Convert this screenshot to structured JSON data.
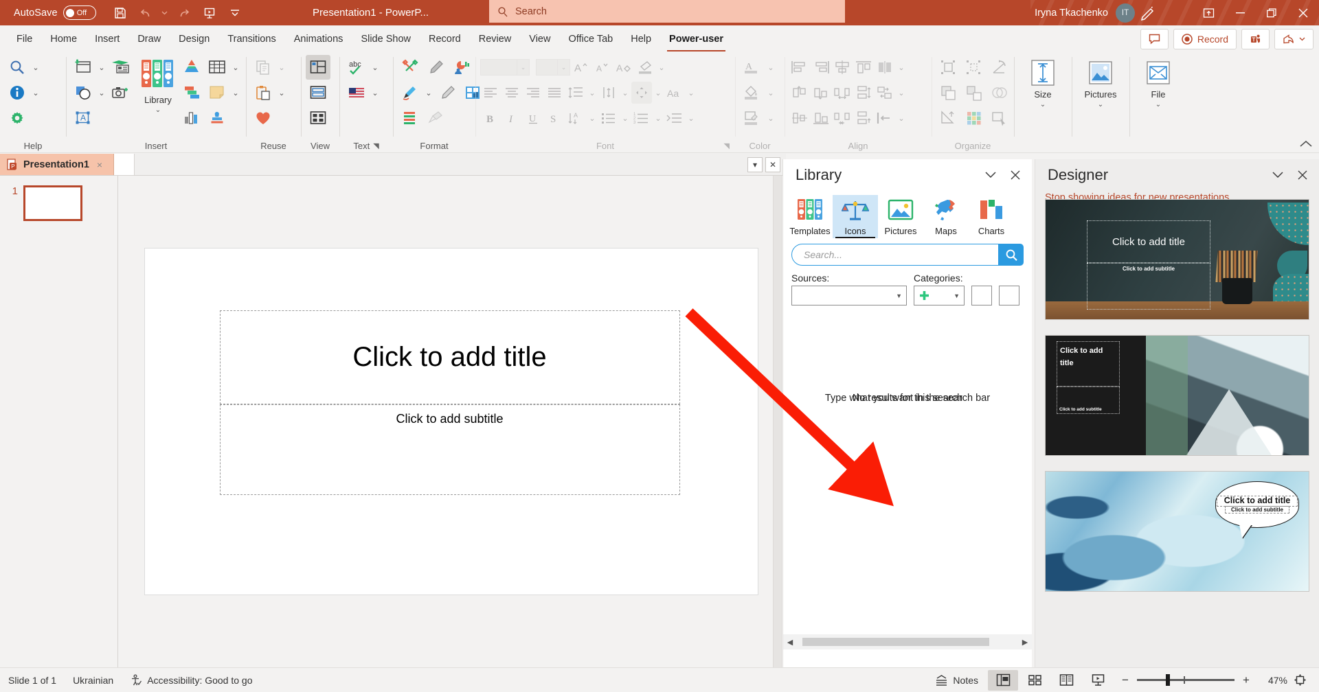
{
  "titlebar": {
    "autosave_label": "AutoSave",
    "autosave_state": "Off",
    "document_title": "Presentation1  -  PowerP...",
    "search_placeholder": "Search",
    "user_name": "Iryna Tkachenko",
    "user_initials": "IT",
    "quick_access": [
      "save-icon",
      "undo-icon",
      "redo-icon",
      "start-slideshow-icon",
      "customize-qat-icon"
    ],
    "window_controls": [
      "minimize",
      "restore",
      "close"
    ],
    "accent_color": "#b7472a"
  },
  "ribbon": {
    "tabs": [
      {
        "label": "File",
        "active": false
      },
      {
        "label": "Home",
        "active": false
      },
      {
        "label": "Insert",
        "active": false
      },
      {
        "label": "Draw",
        "active": false
      },
      {
        "label": "Design",
        "active": false
      },
      {
        "label": "Transitions",
        "active": false
      },
      {
        "label": "Animations",
        "active": false
      },
      {
        "label": "Slide Show",
        "active": false
      },
      {
        "label": "Record",
        "active": false
      },
      {
        "label": "Review",
        "active": false
      },
      {
        "label": "View",
        "active": false
      },
      {
        "label": "Office Tab",
        "active": false
      },
      {
        "label": "Help",
        "active": false
      },
      {
        "label": "Power-user",
        "active": true
      }
    ],
    "right_buttons": [
      {
        "label": "",
        "name": "comments-button",
        "icon": "comment-icon"
      },
      {
        "label": "Record",
        "name": "record-button",
        "icon": "record-circle-icon"
      },
      {
        "label": "",
        "name": "teams-button",
        "icon": "teams-icon"
      },
      {
        "label": "",
        "name": "share-button",
        "icon": "share-icon"
      }
    ],
    "groups": [
      {
        "label": "Help"
      },
      {
        "label": "Insert",
        "big_button": "Library"
      },
      {
        "label": "Reuse"
      },
      {
        "label": "View"
      },
      {
        "label": "Text"
      },
      {
        "label": "Format"
      },
      {
        "label": "Font"
      },
      {
        "label": "Color"
      },
      {
        "label": "Align"
      },
      {
        "label": "Organize"
      },
      {
        "label": "Size"
      },
      {
        "label": "Pictures"
      },
      {
        "label": "File"
      }
    ],
    "big_buttons": [
      {
        "label": "Size",
        "name": "size-button"
      },
      {
        "label": "Pictures",
        "name": "pictures-button"
      },
      {
        "label": "File",
        "name": "file-button"
      }
    ]
  },
  "office_tabs": {
    "tabs": [
      {
        "label": "Presentation1",
        "active": true
      }
    ],
    "close_symbol": "×"
  },
  "thumbnails": {
    "slides": [
      {
        "number": "1"
      }
    ]
  },
  "slide": {
    "title_placeholder": "Click to add title",
    "subtitle_placeholder": "Click to add subtitle"
  },
  "library": {
    "title": "Library",
    "tabs": [
      {
        "label": "Templates",
        "selected": false,
        "icon": "binders-icon"
      },
      {
        "label": "Icons",
        "selected": true,
        "icon": "scales-icon"
      },
      {
        "label": "Pictures",
        "selected": false,
        "icon": "picture-icon"
      },
      {
        "label": "Maps",
        "selected": false,
        "icon": "map-icon"
      },
      {
        "label": "Charts",
        "selected": false,
        "icon": "bar-chart-icon"
      }
    ],
    "search_placeholder": "Search...",
    "sources_label": "Sources:",
    "sources_value": "",
    "categories_label": "Categories:",
    "message_primary": "Type what you want in the search bar",
    "message_secondary": "No results for this search"
  },
  "designer": {
    "title": "Designer",
    "stop_link": "Stop showing ideas for new presentations",
    "ideas": [
      {
        "name": "chalkboard-pencils-design",
        "title": "Click to add title",
        "subtitle": "Click to add subtitle"
      },
      {
        "name": "mountains-design",
        "title": "Click to add title",
        "subtitle": "Click to add subtitle"
      },
      {
        "name": "watercolor-ink-design",
        "title": "Click to add title",
        "subtitle": "Click to add subtitle"
      }
    ]
  },
  "statusbar": {
    "slide_count": "Slide 1 of 1",
    "language": "Ukrainian",
    "accessibility": "Accessibility: Good to go",
    "notes_label": "Notes",
    "zoom_level": "47%",
    "zoom_minus": "−",
    "zoom_plus": "+",
    "views": [
      {
        "name": "normal-view-button",
        "active": true
      },
      {
        "name": "slide-sorter-button",
        "active": false
      },
      {
        "name": "reading-view-button",
        "active": false
      },
      {
        "name": "slideshow-button",
        "active": false
      }
    ]
  }
}
